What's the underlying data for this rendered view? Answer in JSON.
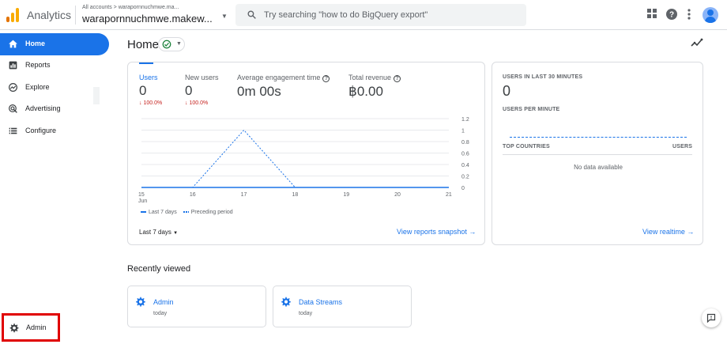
{
  "header": {
    "app_name": "Analytics",
    "account_breadcrumb": "All accounts > warapornnuchmwe.ma...",
    "account_name": "warapornnuchmwe.makew...",
    "search_placeholder": "Try searching \"how to do BigQuery export\""
  },
  "sidebar": {
    "items": [
      {
        "label": "Home",
        "icon": "home-icon",
        "active": true
      },
      {
        "label": "Reports",
        "icon": "reports-icon"
      },
      {
        "label": "Explore",
        "icon": "explore-icon"
      },
      {
        "label": "Advertising",
        "icon": "advertising-icon"
      },
      {
        "label": "Configure",
        "icon": "configure-icon"
      }
    ],
    "admin_label": "Admin"
  },
  "page": {
    "title": "Home"
  },
  "overview": {
    "metrics": [
      {
        "label": "Users",
        "value": "0",
        "delta": "↓ 100.0%"
      },
      {
        "label": "New users",
        "value": "0",
        "delta": "↓ 100.0%"
      },
      {
        "label": "Average engagement time",
        "value": "0m 00s"
      },
      {
        "label": "Total revenue",
        "value": "฿0.00"
      }
    ],
    "legend": {
      "current": "Last 7 days",
      "previous": "Preceding period"
    },
    "date_range": "Last 7 days",
    "view_link": "View reports snapshot"
  },
  "chart_data": {
    "type": "line",
    "x": [
      "15 Jun",
      "16",
      "17",
      "18",
      "19",
      "20",
      "21"
    ],
    "x_tick_labels": [
      "15",
      "16",
      "17",
      "18",
      "19",
      "20",
      "21"
    ],
    "x_sublabel": "Jun",
    "y_ticks": [
      "0",
      "0.2",
      "0.4",
      "0.6",
      "0.8",
      "1",
      "1.2"
    ],
    "ylim": [
      0,
      1.2
    ],
    "series": [
      {
        "name": "Last 7 days",
        "values": [
          0,
          0,
          0,
          0,
          0,
          0,
          0
        ],
        "style": "solid"
      },
      {
        "name": "Preceding period",
        "values": [
          0,
          0,
          1,
          0,
          0,
          0,
          0
        ],
        "style": "dashed"
      }
    ],
    "color": "#1a73e8",
    "grid": true,
    "legend_position": "bottom-left"
  },
  "realtime": {
    "title": "USERS IN LAST 30 MINUTES",
    "value": "0",
    "per_minute_label": "USERS PER MINUTE",
    "countries_header": "TOP COUNTRIES",
    "users_header": "USERS",
    "no_data": "No data available",
    "view_link": "View realtime"
  },
  "recently_viewed": {
    "title": "Recently viewed",
    "items": [
      {
        "title": "Admin",
        "sub": "today"
      },
      {
        "title": "Data Streams",
        "sub": "today"
      }
    ]
  },
  "colors": {
    "accent": "#1a73e8",
    "negative": "#c5221f",
    "highlight_box": "#e00000"
  }
}
